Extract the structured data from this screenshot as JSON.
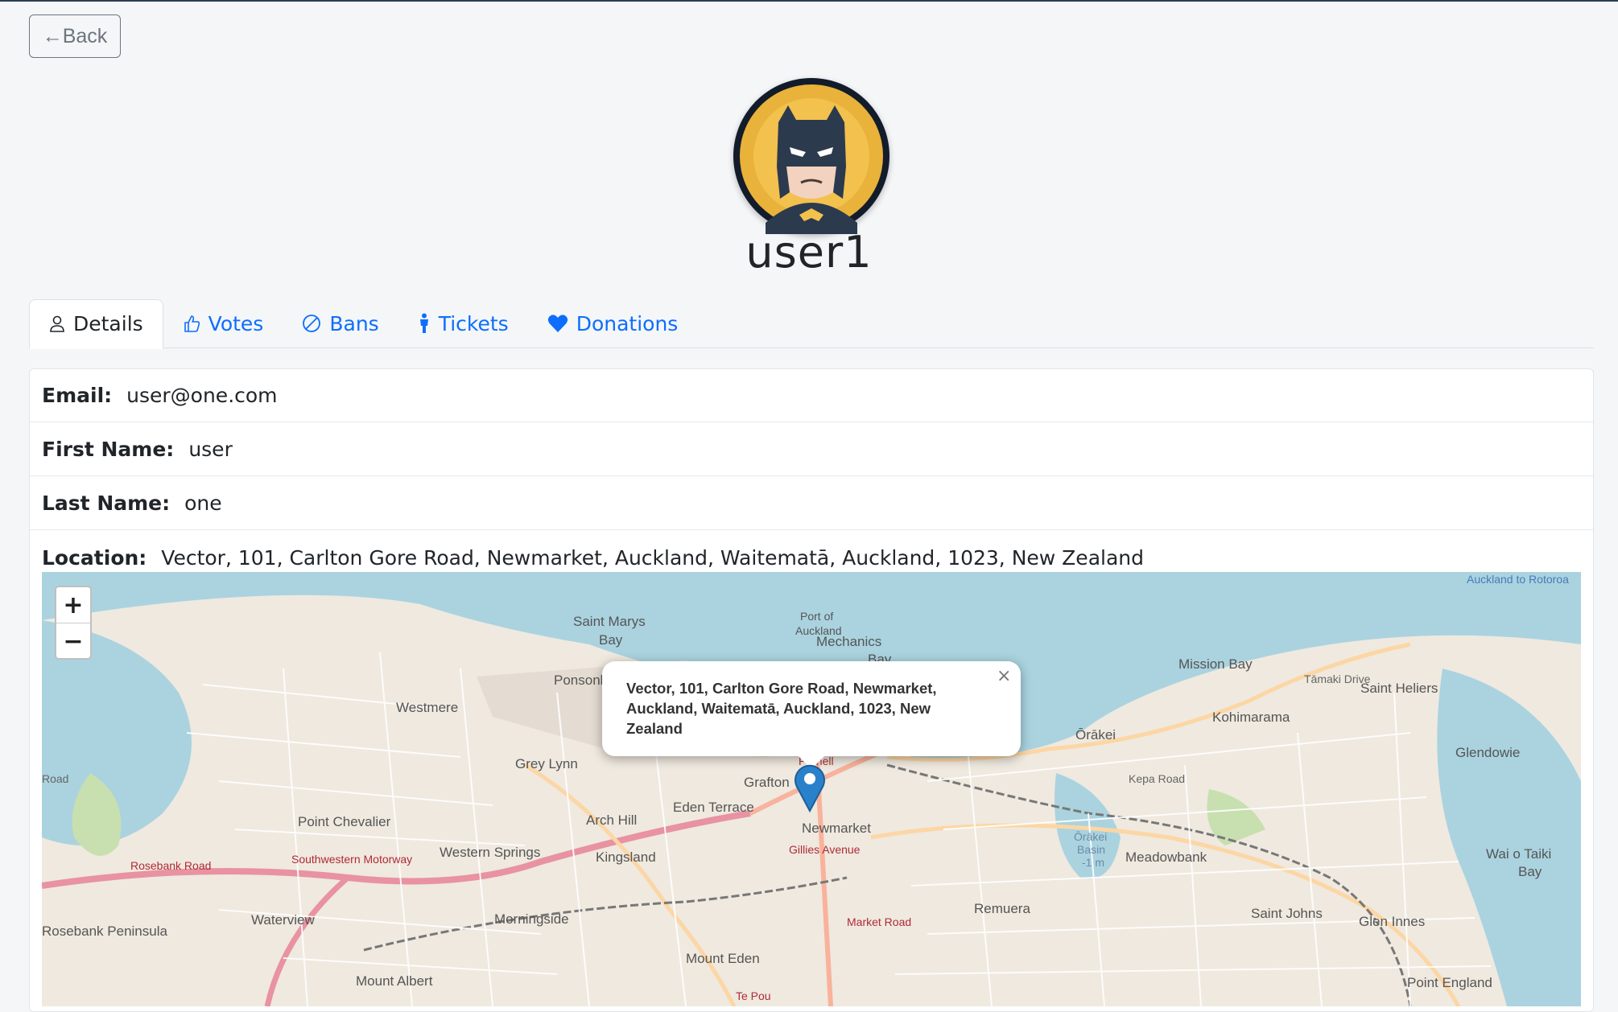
{
  "back_button": {
    "label": "←Back"
  },
  "profile": {
    "username": "user1"
  },
  "tabs": [
    {
      "label": "Details",
      "icon": "person-icon",
      "active": true
    },
    {
      "label": "Votes",
      "icon": "thumbs-up-icon"
    },
    {
      "label": "Bans",
      "icon": "ban-icon"
    },
    {
      "label": "Tickets",
      "icon": "ticket-person-icon"
    },
    {
      "label": "Donations",
      "icon": "heart-icon"
    }
  ],
  "details": {
    "email": {
      "label": "Email:",
      "value": "user@one.com"
    },
    "first_name": {
      "label": "First Name:",
      "value": "user"
    },
    "last_name": {
      "label": "Last Name:",
      "value": "one"
    },
    "location": {
      "label": "Location:",
      "value": "Vector, 101, Carlton Gore Road, Newmarket, Auckland, Waitematā, Auckland, 1023, New Zealand"
    }
  },
  "map": {
    "zoom_in": "+",
    "zoom_out": "−",
    "popup_text": "Vector, 101, Carlton Gore Road, Newmarket, Auckland, Waitematā, Auckland, 1023, New Zealand",
    "popup_close": "×",
    "place_labels": [
      "Saint Marys Bay",
      "Ponsonby",
      "Westmere",
      "Grey Lynn",
      "Point Chevalier",
      "Arch Hill",
      "Grafton",
      "Eden Terrace",
      "Newmarket",
      "Kingsland",
      "Western Springs",
      "Waterview",
      "Morningside",
      "Mount Eden",
      "Mount Albert",
      "Port of Auckland",
      "Mechanics Bay",
      "Mission Bay",
      "Saint Heliers",
      "Kohimarama",
      "Ōrākei",
      "Glendowie",
      "Meadowbank",
      "Remuera",
      "Saint Johns",
      "Glen Innes",
      "Wai o Taiki Bay",
      "Point England",
      "Ōrākei Basin",
      "-1 m",
      "Parnell",
      "Rosebank Peninsula"
    ],
    "road_labels": [
      "Rosebank Road",
      "Southwestern Motorway",
      "Gillies Avenue",
      "Market Road",
      "Tāmaki Drive",
      "Kepa Road",
      "Auckland to Rotoroa",
      "Road",
      "Te Pou"
    ]
  }
}
